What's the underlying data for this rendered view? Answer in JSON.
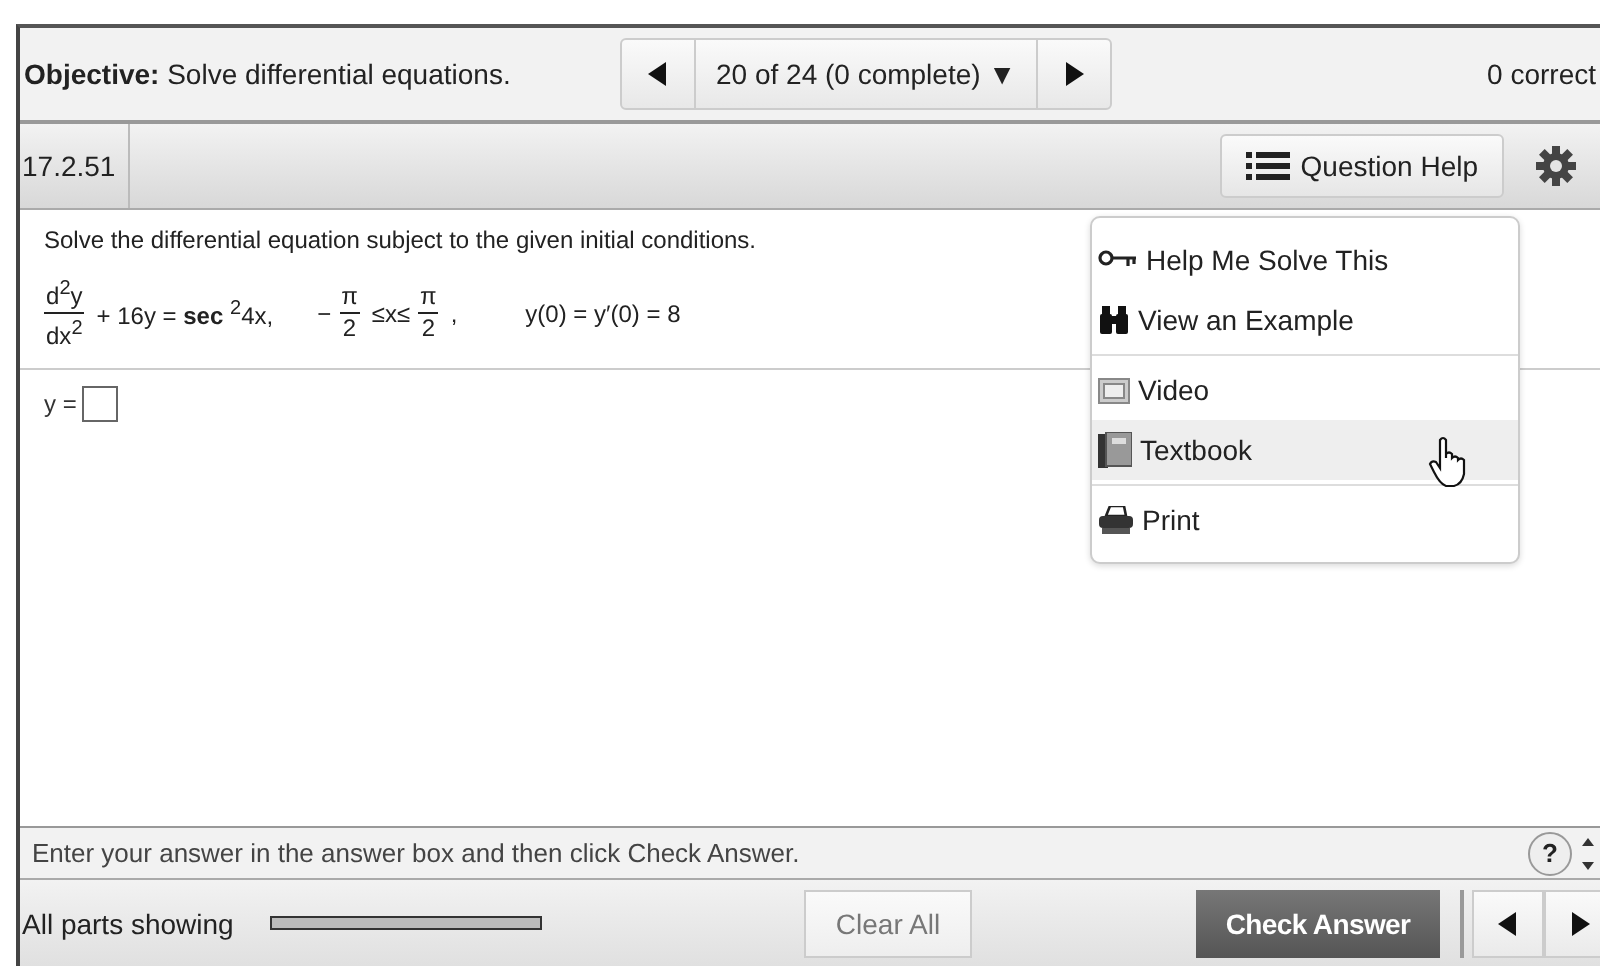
{
  "header": {
    "objective_label": "Objective:",
    "objective": "Solve differential equations.",
    "nav": {
      "position": "20 of 24 (0 complete)",
      "dropdown_icon": "▼"
    },
    "score": "0 correct"
  },
  "toolbar": {
    "question_id": "17.2.51",
    "help_button": "Question Help"
  },
  "question": {
    "instruction": "Solve the differential equation subject to the given initial conditions.",
    "equation": [
      {
        "kind": "fraction",
        "num": "d$^{2}$y",
        "den": "dx$^{2}$"
      },
      {
        "kind": "text",
        "text": "+ 16y = **sec** $^{2}$4x,"
      },
      {
        "kind": "text",
        "text": "−"
      },
      {
        "kind": "fraction",
        "num": "π",
        "den": "2"
      },
      {
        "kind": "text",
        "text": "≤x≤"
      },
      {
        "kind": "fraction",
        "num": "π",
        "den": "2"
      },
      {
        "kind": "text",
        "text": ","
      },
      {
        "kind": "text",
        "text": "y(0) = y′(0) = 8"
      }
    ],
    "answer_label": "y ="
  },
  "help_menu": {
    "groups": [
      [
        {
          "kind": "key",
          "label": "Help Me Solve This",
          "selected": false
        },
        {
          "kind": "binoculars",
          "label": "View an Example",
          "selected": false
        }
      ],
      [
        {
          "kind": "film",
          "label": "Video",
          "selected": false
        },
        {
          "kind": "book",
          "label": "Textbook",
          "selected": true
        }
      ],
      [
        {
          "kind": "printer",
          "label": "Print",
          "selected": false
        }
      ]
    ]
  },
  "hint_bar": {
    "text": "Enter your answer in the answer box and then click Check Answer.",
    "help_icon": "?"
  },
  "footer": {
    "parts_label": "All parts showing",
    "progress": {
      "level": 1
    },
    "clear_button": "Clear All",
    "check_button": "Check Answer"
  }
}
